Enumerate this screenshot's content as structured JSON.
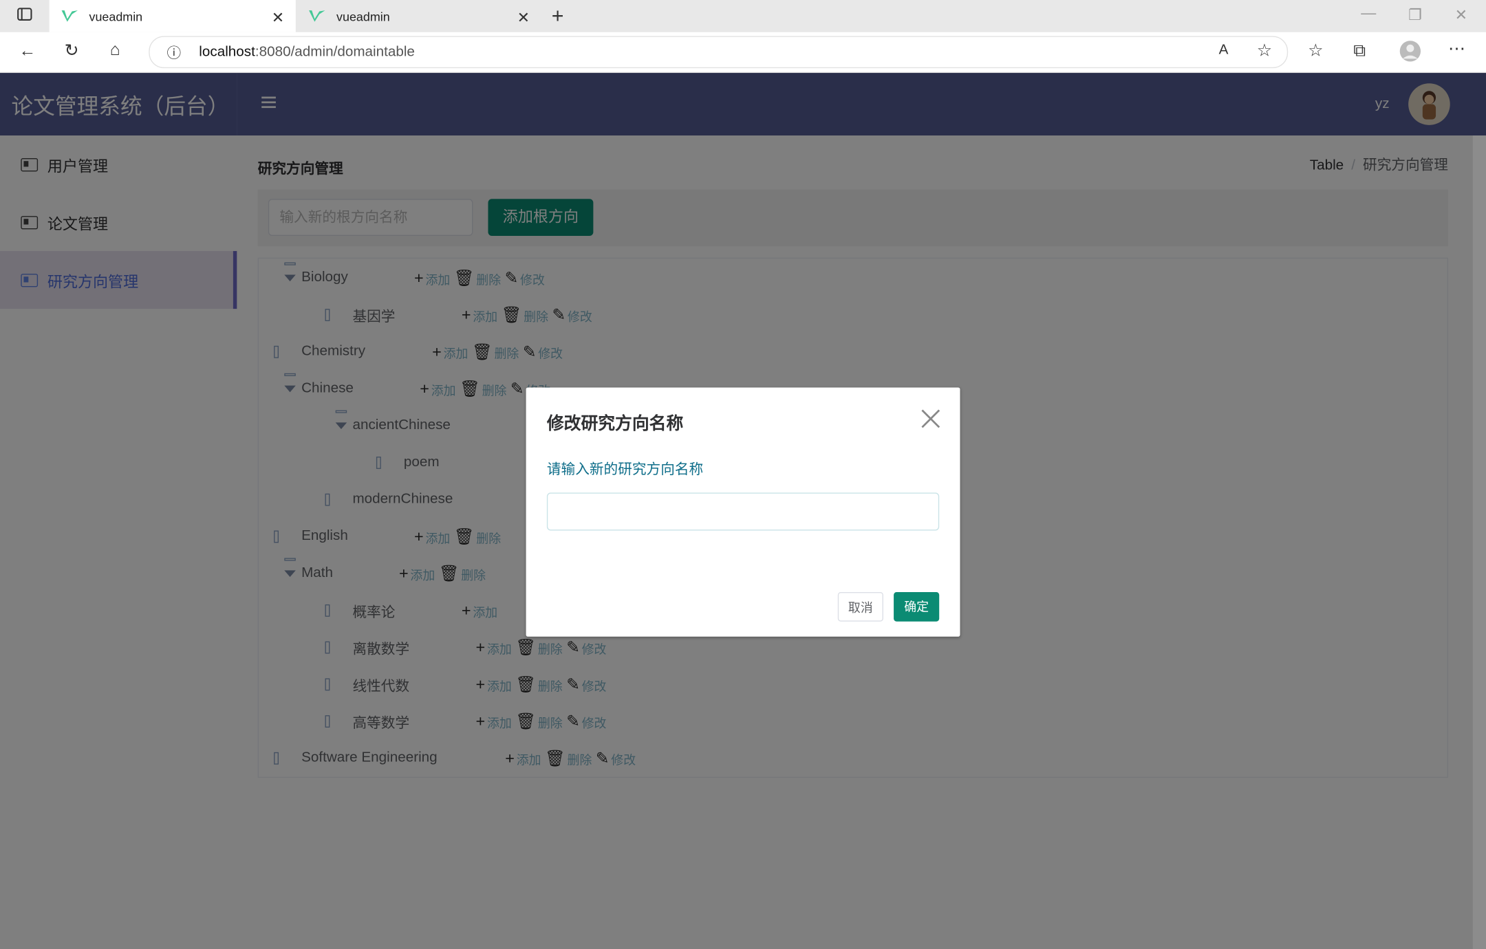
{
  "browser": {
    "tabs": [
      {
        "title": "vueadmin",
        "active": true
      },
      {
        "title": "vueadmin",
        "active": false
      }
    ],
    "url_host": "localhost",
    "url_path": ":8080/admin/domaintable"
  },
  "app": {
    "brand": "论文管理系统（后台）",
    "user": "yz",
    "menu": [
      {
        "label": "用户管理",
        "active": false
      },
      {
        "label": "论文管理",
        "active": false
      },
      {
        "label": "研究方向管理",
        "active": true
      }
    ],
    "page_title": "研究方向管理",
    "breadcrumb": [
      "Table",
      "研究方向管理"
    ],
    "root_input_placeholder": "输入新的根方向名称",
    "root_add_button": "添加根方向",
    "ops": {
      "add": "添加",
      "delete": "删除",
      "edit": "修改"
    },
    "tree": [
      {
        "label": "Biology",
        "level": 0,
        "expanded": true,
        "children_visible": true
      },
      {
        "label": "基因学",
        "level": 1
      },
      {
        "label": "Chemistry",
        "level": 0
      },
      {
        "label": "Chinese",
        "level": 0,
        "expanded": true
      },
      {
        "label": "ancientChinese",
        "level": 1,
        "expanded": true
      },
      {
        "label": "poem",
        "level": 2
      },
      {
        "label": "modernChinese",
        "level": 1
      },
      {
        "label": "English",
        "level": 0
      },
      {
        "label": "Math",
        "level": 0,
        "expanded": true
      },
      {
        "label": "概率论",
        "level": 1
      },
      {
        "label": "离散数学",
        "level": 1
      },
      {
        "label": "线性代数",
        "level": 1
      },
      {
        "label": "高等数学",
        "level": 1
      },
      {
        "label": "Software Engineering",
        "level": 0
      }
    ]
  },
  "dialog": {
    "title": "修改研究方向名称",
    "label": "请输入新的研究方向名称",
    "input_value": "",
    "cancel": "取消",
    "confirm": "确定"
  }
}
